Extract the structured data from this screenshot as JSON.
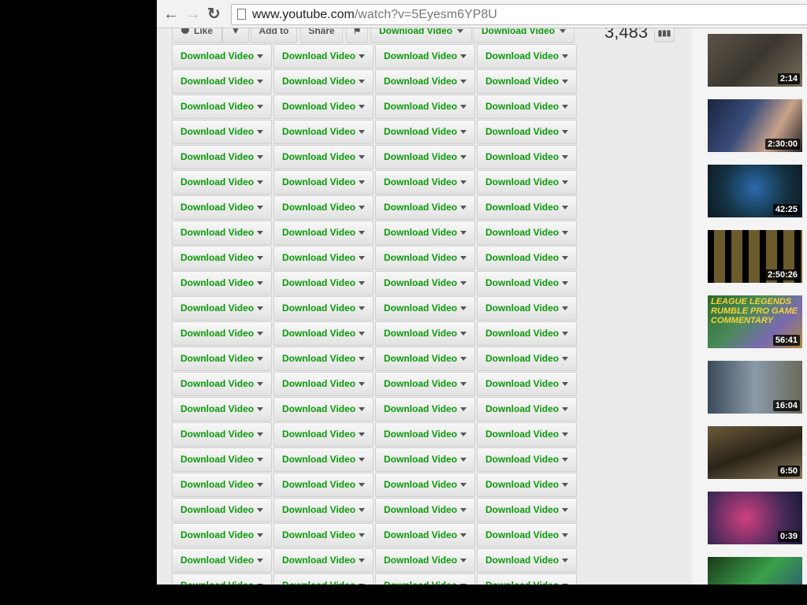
{
  "browser": {
    "url_host": "www.youtube.com",
    "url_path": "/watch?v=5Eyesm6YP8U"
  },
  "actions": {
    "like": "Like",
    "add_to": "Add to",
    "share": "Share",
    "download_label": "Download Video"
  },
  "view_count": "3,483",
  "thumbnails": [
    {
      "duration": "2:14",
      "bg": "linear-gradient(135deg,#5a5448,#3b362e 50%,#786e5c)"
    },
    {
      "duration": "2:30:00",
      "bg": "linear-gradient(120deg,#1a2440,#3a4d7a 40%,#c9a28a 70%,#222)"
    },
    {
      "duration": "42:25",
      "bg": "radial-gradient(circle at 50% 45%,#2a6aa8,#143040 60%,#0d1a24)"
    },
    {
      "duration": "2:50:26",
      "bg": "repeating-linear-gradient(90deg,#000 0 8px,#6b5a2c 8px 22px)"
    },
    {
      "duration": "56:41",
      "bg": "linear-gradient(135deg,#2a6a2a,#4a8a5a 40%,#7a6ab0 70%,#b08a3a)",
      "title": "LEAGUE LEGENDS RUMBLE PRO GAME COMMENTARY"
    },
    {
      "duration": "16:04",
      "bg": "linear-gradient(90deg,#3a4a5a,#8a9aa8 50%,#6a6a5a)"
    },
    {
      "duration": "6:50",
      "bg": "linear-gradient(160deg,#6a5a3a,#2a2418 50%,#8a7a5a)"
    },
    {
      "duration": "0:39",
      "bg": "radial-gradient(circle at 40% 50%,#d04080,#4a2a5a 60%,#1a1a3a)"
    },
    {
      "duration": "",
      "bg": "linear-gradient(135deg,#1a3a1a,#3aa04a 50%,#2a4a7a)"
    }
  ]
}
